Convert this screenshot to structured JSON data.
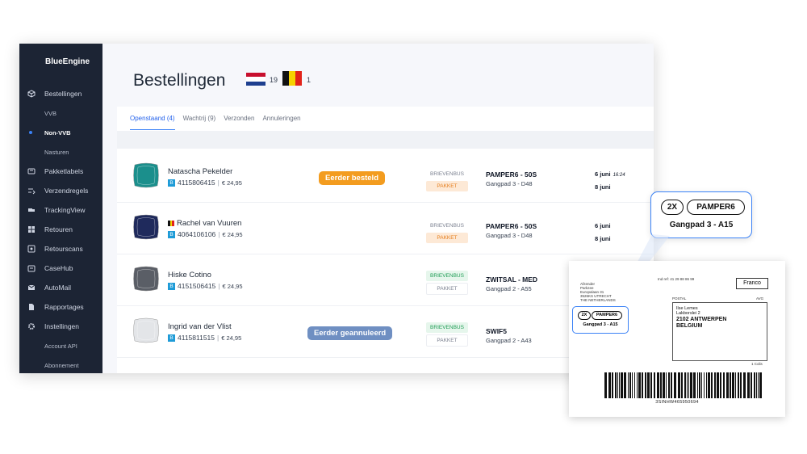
{
  "app": {
    "brand": "BlueEngine",
    "page_title": "Bestellingen",
    "flags": [
      {
        "country": "NL",
        "count": "19"
      },
      {
        "country": "BE",
        "count": "1"
      }
    ]
  },
  "sidebar": {
    "items": [
      {
        "label": "Bestellingen",
        "icon": "box-icon",
        "type": "main"
      },
      {
        "label": "VVB",
        "type": "sub"
      },
      {
        "label": "Non-VVB",
        "type": "sub-active"
      },
      {
        "label": "Nasturen",
        "type": "sub"
      },
      {
        "label": "Pakketlabels",
        "icon": "label-icon",
        "type": "main"
      },
      {
        "label": "Verzendregels",
        "icon": "rules-icon",
        "type": "main"
      },
      {
        "label": "TrackingView",
        "icon": "truck-icon",
        "type": "main"
      },
      {
        "label": "Retouren",
        "icon": "grid-icon",
        "type": "main"
      },
      {
        "label": "Retourscans",
        "icon": "scan-icon",
        "type": "main"
      },
      {
        "label": "CaseHub",
        "icon": "case-icon",
        "type": "main"
      },
      {
        "label": "AutoMail",
        "icon": "mail-icon",
        "type": "main"
      },
      {
        "label": "Rapportages",
        "icon": "report-icon",
        "type": "main"
      },
      {
        "label": "Instellingen",
        "icon": "gear-icon",
        "type": "main"
      },
      {
        "label": "Account API",
        "type": "sub"
      },
      {
        "label": "Abonnement",
        "type": "sub"
      }
    ]
  },
  "tabs": [
    {
      "label": "Openstaand (4)",
      "active": true
    },
    {
      "label": "Wachtrij (9)"
    },
    {
      "label": "Verzonden"
    },
    {
      "label": "Annuleringen"
    }
  ],
  "orders": [
    {
      "name": "Natascha Pekelder",
      "order": "4115806415",
      "price": "€ 24,95",
      "badge": "Eerder besteld",
      "badge_color": "#f39c1f",
      "ship1": "BRIEVENBUS",
      "ship2": "PAKKET",
      "ship_active": 2,
      "product": "PAMPER6 - 50S",
      "location": "Gangpad 3 - D48",
      "date1": "6 juni",
      "time": "16:24",
      "date2": "8 juni",
      "thumb_color": "#1b8f8c"
    },
    {
      "name": "Rachel van Vuuren",
      "flag": "BE",
      "order": "4064106106",
      "price": "€ 24,95",
      "ship1": "BRIEVENBUS",
      "ship2": "PAKKET",
      "ship_active": 2,
      "product": "PAMPER6 - 50S",
      "location": "Gangpad 3 - D48",
      "date1": "6 juni",
      "date2": "8 juni",
      "thumb_color": "#1f2a5c"
    },
    {
      "name": "Hiske Cotino",
      "order": "4151506415",
      "price": "€ 24,95",
      "ship1": "BRIEVENBUS",
      "ship2": "PAKKET",
      "ship_active": 1,
      "product": "ZWITSAL - MED",
      "location": "Gangpad 2 - A55",
      "thumb_color": "#5a5e66"
    },
    {
      "name": "Ingrid van der Vlist",
      "order": "4115811515",
      "price": "€ 24,95",
      "badge": "Eerder geannuleerd",
      "badge_color": "#6f8fc2",
      "ship1": "BRIEVENBUS",
      "ship2": "PAKKET",
      "ship_active": 1,
      "product": "SWIF5",
      "location": "Gangpad 2 - A43",
      "thumb_color": "#e3e5e8"
    }
  ],
  "callout": {
    "qty": "2X",
    "sku": "PAMPER6",
    "location": "Gangpad 3 - A15"
  },
  "shipping_label": {
    "sender": [
      "Afzender",
      "Parkzee",
      "Europalaan 31",
      "3526KS UTRECHT",
      "THE NETHERLANDS"
    ],
    "ref": "Ind ref: 41 29 88 86 99",
    "franco": "Franco",
    "postal": "POSTAL",
    "avg": "AVG",
    "addr_small": [
      "Ilse Lemes",
      "Lakborslei 2"
    ],
    "addr_big": [
      "2102 ANTWERPEN",
      "BELGIUM"
    ],
    "colli": "1 Colis",
    "barcode": "3SINHW465950694",
    "mini_qty": "2X",
    "mini_sku": "PAMPER6",
    "mini_loc": "Gangpad 3 - A15"
  },
  "colors": {
    "sidebar": "#1c2434",
    "accent": "#3b82f6",
    "orange": "#f39c1f",
    "muted_blue": "#6f8fc2"
  }
}
